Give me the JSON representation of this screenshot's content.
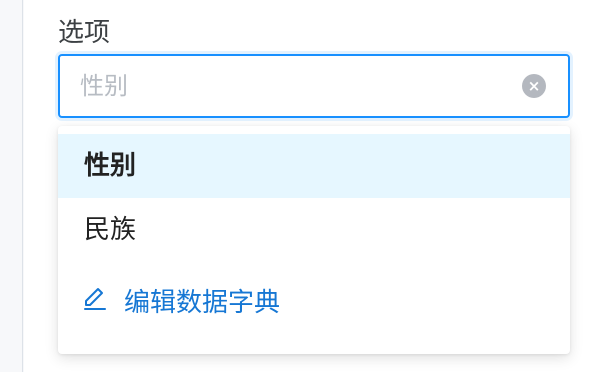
{
  "field": {
    "label": "选项",
    "placeholder": "性别",
    "value": ""
  },
  "dropdown": {
    "options": [
      {
        "label": "性别",
        "selected": true
      },
      {
        "label": "民族",
        "selected": false
      }
    ],
    "edit_link_label": "编辑数据字典"
  },
  "icons": {
    "clear": "close-circle-icon",
    "edit": "pencil-icon"
  },
  "colors": {
    "accent": "#1890ff",
    "link": "#1677d4",
    "selected_bg": "#e6f7ff"
  }
}
